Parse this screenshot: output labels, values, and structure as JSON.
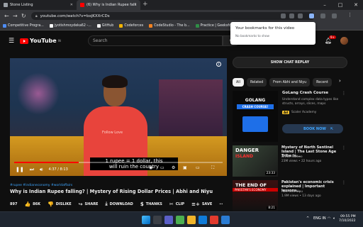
{
  "browser": {
    "tabs": [
      {
        "title": "Stone Listing"
      },
      {
        "title": "(6) Why is Indian Rupee falli"
      }
    ],
    "url": "youtube.com/watch?v=bxjKXXrCDs",
    "bookmarks": [
      "Competitive Progra...",
      "jyotishmoydeka62 -...",
      "GitHub",
      "Codeforces",
      "CodeStudio - The b...",
      "Practice | Geeksfor..."
    ],
    "popup": {
      "title": "Your bookmarks for this video",
      "body": "No bookmarks to show"
    }
  },
  "youtube": {
    "logo_text": "YouTube",
    "logo_country": "IN",
    "search_placeholder": "Search",
    "notification_count": "9+"
  },
  "player": {
    "caption_line1": "1 rupee = 1 dollar, this",
    "caption_line2": "will ruin the country",
    "time": "4:37 / 8:13",
    "progress": 0.31,
    "shirt_text": "Follow Love"
  },
  "video": {
    "hashtags": "#rupee #indianeconomy #worldaffairs",
    "title": "Why is Indian Rupee falling? | Mystery of Rising Dollar Prices | Abhi and Niyu",
    "views_short": "897",
    "actions": [
      {
        "icon": "thumbs-up-icon",
        "glyph": "👍",
        "label": "86K"
      },
      {
        "icon": "thumbs-down-icon",
        "glyph": "👎",
        "label": "DISLIKE"
      },
      {
        "icon": "share-icon",
        "glyph": "↪",
        "label": "SHARE"
      },
      {
        "icon": "download-icon",
        "glyph": "⤓",
        "label": "DOWNLOAD"
      },
      {
        "icon": "thanks-icon",
        "glyph": "$",
        "label": "THANKS"
      },
      {
        "icon": "clip-icon",
        "glyph": "✂",
        "label": "CLIP"
      },
      {
        "icon": "save-icon",
        "glyph": "≡+",
        "label": "SAVE"
      }
    ]
  },
  "sidebar": {
    "chat_replay": "SHOW CHAT REPLAY",
    "chips": [
      "All",
      "Related",
      "From Abhi and Niyu",
      "Recent"
    ],
    "ad": {
      "title": "GoLang Crash Course",
      "description": "Understand complex data types like structs, arrays, slices, maps",
      "badge": "Ad",
      "advertiser": "Scaler Academy",
      "cta": "BOOK NOW",
      "thumb_title": "GOLANG",
      "thumb_sub": "CRASH COURSE!"
    },
    "videos": [
      {
        "title": "Mystery of North Sentinel Island | The Last Stone Age Tribe in...",
        "channel": "Dhruv Rathee",
        "meta": "23M views • 22 hours ago",
        "duration": "23:33",
        "thumb_l1": "DANGER",
        "thumb_l2": "ISLAND"
      },
      {
        "title": "Pakistan's economic crisis explained | Important lessons...",
        "channel": "Abhi and Niyu",
        "meta": "1.9M views • 13 days ago",
        "duration": "8:21",
        "thumb_l1": "THE END OF",
        "thumb_l2": "PAKISTAN'S ECONOMY"
      }
    ]
  },
  "taskbar": {
    "lang": "ENG IN",
    "time": "09:55 PM",
    "date": "7/10/2022"
  }
}
